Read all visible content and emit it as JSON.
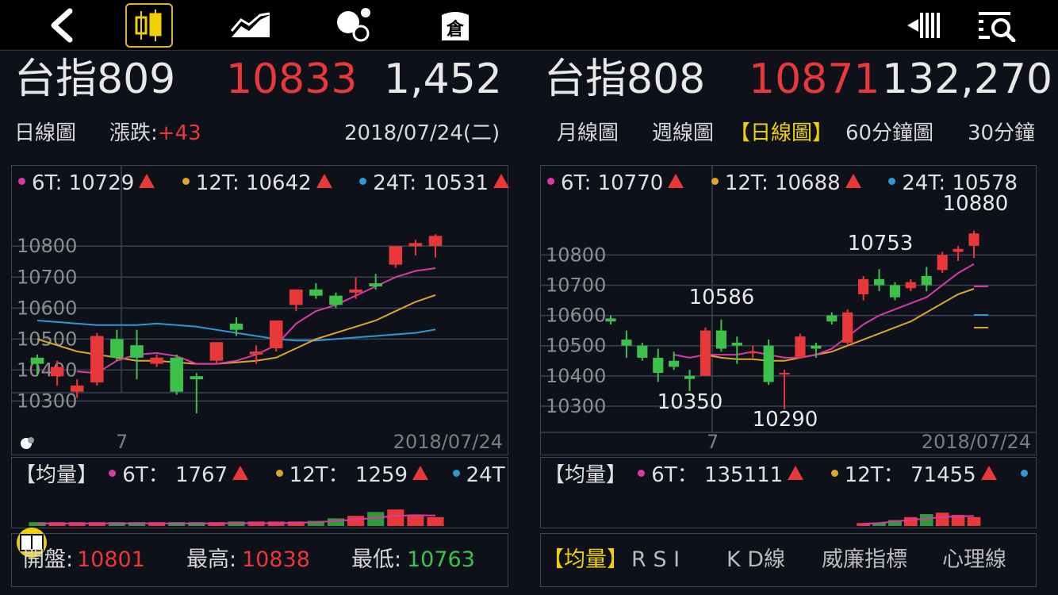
{
  "toolbar": {
    "back": "back-icon",
    "candlestick": "candlestick-icon",
    "trend": "trend-chart-icon",
    "bubbles": "bubble-icon",
    "warehouse": "warehouse-icon",
    "signal": "signal-icon",
    "search": "list-search-icon"
  },
  "left": {
    "name": "台指809",
    "price": "10833",
    "volume": "1,452",
    "period": "日線圖",
    "change_label": "漲跌:",
    "change_value": "+43",
    "date": "2018/07/24(二)",
    "ma": [
      {
        "label": "6T: 10729",
        "color": "#d63aa8"
      },
      {
        "label": "12T: 10642",
        "color": "#e0a428"
      },
      {
        "label": "24T: 10531",
        "color": "#2c98d8"
      }
    ],
    "x_tick": "7",
    "end_date": "2018/07/24",
    "vol_title": "【均量】",
    "vol_ma": [
      {
        "label": "6T： 1767",
        "color": "#d63aa8"
      },
      {
        "label": "12T： 1259",
        "color": "#e0a428"
      },
      {
        "label": "24T",
        "color": "#2c98d8"
      }
    ],
    "open_label": "開盤:",
    "open_value": "10801",
    "high_label": "最高:",
    "high_value": "10838",
    "low_label": "最低:",
    "low_value": "10763"
  },
  "right": {
    "name": "台指808",
    "price": "10871",
    "volume": "132,270",
    "tabs": [
      "月線圖",
      "週線圖",
      "【日線圖】",
      "60分鐘圖",
      "30分鐘"
    ],
    "active_tab": 2,
    "ma": [
      {
        "label": "6T: 10770",
        "color": "#d63aa8"
      },
      {
        "label": "12T: 10688",
        "color": "#e0a428"
      },
      {
        "label": "24T: 10578",
        "color": "#2c98d8"
      }
    ],
    "x_tick": "7",
    "end_date": "2018/07/24",
    "annotations": [
      "10880",
      "10753",
      "10586",
      "10350",
      "10290"
    ],
    "vol_title": "【均量】",
    "vol_ma": [
      {
        "label": "6T： 135111",
        "color": "#d63aa8"
      },
      {
        "label": "12T： 71455",
        "color": "#e0a428"
      },
      {
        "label": "",
        "color": "#2c98d8"
      }
    ],
    "indicator_tabs": [
      "【均量】",
      "R S I",
      "K D線",
      "威廉指標",
      "心理線"
    ]
  },
  "colors": {
    "up": "#e8383a",
    "down": "#3cc24a",
    "accent": "#d9b230"
  },
  "chart_data": [
    {
      "type": "bar",
      "subtype": "candlestick",
      "yticks": [
        10300,
        10400,
        10500,
        10600,
        10700,
        10800
      ],
      "ylim": [
        10250,
        10880
      ],
      "candles": [
        {
          "o": 10440,
          "h": 10450,
          "l": 10380,
          "c": 10420
        },
        {
          "o": 10380,
          "h": 10430,
          "l": 10350,
          "c": 10410
        },
        {
          "o": 10330,
          "h": 10370,
          "l": 10310,
          "c": 10350
        },
        {
          "o": 10360,
          "h": 10520,
          "l": 10350,
          "c": 10510
        },
        {
          "o": 10500,
          "h": 10530,
          "l": 10430,
          "c": 10440
        },
        {
          "o": 10480,
          "h": 10530,
          "l": 10370,
          "c": 10440
        },
        {
          "o": 10420,
          "h": 10450,
          "l": 10410,
          "c": 10440
        },
        {
          "o": 10440,
          "h": 10450,
          "l": 10320,
          "c": 10330
        },
        {
          "o": 10380,
          "h": 10390,
          "l": 10260,
          "c": 10370
        },
        {
          "o": 10430,
          "h": 10490,
          "l": 10420,
          "c": 10490
        },
        {
          "o": 10550,
          "h": 10570,
          "l": 10510,
          "c": 10530
        },
        {
          "o": 10450,
          "h": 10480,
          "l": 10420,
          "c": 10460
        },
        {
          "o": 10470,
          "h": 10560,
          "l": 10460,
          "c": 10560
        },
        {
          "o": 10610,
          "h": 10660,
          "l": 10590,
          "c": 10660
        },
        {
          "o": 10660,
          "h": 10680,
          "l": 10630,
          "c": 10640
        },
        {
          "o": 10640,
          "h": 10650,
          "l": 10600,
          "c": 10610
        },
        {
          "o": 10650,
          "h": 10700,
          "l": 10630,
          "c": 10660
        },
        {
          "o": 10680,
          "h": 10710,
          "l": 10660,
          "c": 10670
        },
        {
          "o": 10740,
          "h": 10800,
          "l": 10730,
          "c": 10800
        },
        {
          "o": 10800,
          "h": 10820,
          "l": 10770,
          "c": 10810
        },
        {
          "o": 10801,
          "h": 10838,
          "l": 10763,
          "c": 10833
        }
      ],
      "ma6": [
        10430,
        10400,
        10395,
        10390,
        10430,
        10450,
        10455,
        10445,
        10420,
        10420,
        10430,
        10450,
        10480,
        10550,
        10590,
        10610,
        10640,
        10670,
        10700,
        10720,
        10729
      ],
      "ma12": [
        10500,
        10480,
        10460,
        10450,
        10440,
        10430,
        10430,
        10425,
        10420,
        10420,
        10425,
        10430,
        10440,
        10470,
        10500,
        10520,
        10540,
        10560,
        10590,
        10620,
        10642
      ],
      "ma24": [
        10560,
        10555,
        10550,
        10545,
        10545,
        10545,
        10550,
        10545,
        10540,
        10530,
        10520,
        10510,
        10500,
        10495,
        10495,
        10500,
        10505,
        10510,
        10515,
        10520,
        10531
      ],
      "volume": [
        60,
        60,
        60,
        60,
        60,
        60,
        60,
        60,
        60,
        60,
        70,
        70,
        70,
        70,
        80,
        120,
        160,
        220,
        260,
        180,
        140
      ],
      "vol_ma": [
        40,
        40,
        40,
        40,
        40,
        40,
        40,
        40,
        40,
        40,
        45,
        45,
        45,
        50,
        60,
        80,
        100,
        130,
        160,
        170,
        165
      ]
    },
    {
      "type": "bar",
      "subtype": "candlestick",
      "yticks": [
        10300,
        10400,
        10500,
        10600,
        10700,
        10800
      ],
      "ylim": [
        10250,
        10890
      ],
      "candles": [
        {
          "o": 10590,
          "h": 10600,
          "l": 10570,
          "c": 10580
        },
        {
          "o": 10520,
          "h": 10550,
          "l": 10460,
          "c": 10500
        },
        {
          "o": 10500,
          "h": 10510,
          "l": 10450,
          "c": 10460
        },
        {
          "o": 10460,
          "h": 10490,
          "l": 10380,
          "c": 10410
        },
        {
          "o": 10450,
          "h": 10480,
          "l": 10420,
          "c": 10430
        },
        {
          "o": 10400,
          "h": 10420,
          "l": 10350,
          "c": 10390
        },
        {
          "o": 10400,
          "h": 10560,
          "l": 10400,
          "c": 10550
        },
        {
          "o": 10550,
          "h": 10586,
          "l": 10480,
          "c": 10490
        },
        {
          "o": 10510,
          "h": 10530,
          "l": 10440,
          "c": 10500
        },
        {
          "o": 10480,
          "h": 10500,
          "l": 10460,
          "c": 10480
        },
        {
          "o": 10500,
          "h": 10520,
          "l": 10370,
          "c": 10380
        },
        {
          "o": 10410,
          "h": 10420,
          "l": 10290,
          "c": 10410
        },
        {
          "o": 10460,
          "h": 10540,
          "l": 10460,
          "c": 10530
        },
        {
          "o": 10500,
          "h": 10510,
          "l": 10460,
          "c": 10490
        },
        {
          "o": 10600,
          "h": 10610,
          "l": 10570,
          "c": 10580
        },
        {
          "o": 10510,
          "h": 10620,
          "l": 10500,
          "c": 10610
        },
        {
          "o": 10670,
          "h": 10730,
          "l": 10650,
          "c": 10720
        },
        {
          "o": 10720,
          "h": 10753,
          "l": 10680,
          "c": 10700
        },
        {
          "o": 10700,
          "h": 10710,
          "l": 10650,
          "c": 10660
        },
        {
          "o": 10690,
          "h": 10720,
          "l": 10680,
          "c": 10710
        },
        {
          "o": 10730,
          "h": 10760,
          "l": 10680,
          "c": 10700
        },
        {
          "o": 10750,
          "h": 10810,
          "l": 10740,
          "c": 10800
        },
        {
          "o": 10810,
          "h": 10830,
          "l": 10780,
          "c": 10820
        },
        {
          "o": 10830,
          "h": 10880,
          "l": 10790,
          "c": 10871
        }
      ],
      "ma6": [
        10540,
        10520,
        10500,
        10480,
        10470,
        10460,
        10470,
        10470,
        10470,
        10480,
        10470,
        10460,
        10460,
        10470,
        10490,
        10530,
        10570,
        10600,
        10620,
        10640,
        10660,
        10700,
        10740,
        10770
      ],
      "ma12": [
        10560,
        10540,
        10520,
        10500,
        10490,
        10480,
        10470,
        10460,
        10455,
        10455,
        10450,
        10450,
        10460,
        10470,
        10480,
        10500,
        10520,
        10540,
        10560,
        10580,
        10610,
        10640,
        10670,
        10688
      ],
      "ma24": [
        10580,
        10570,
        10560,
        10550,
        10545,
        10540,
        10540,
        10540,
        10540,
        10545,
        10550,
        10550,
        10550,
        10550,
        10555,
        10560,
        10560,
        10565,
        10565,
        10570,
        10570,
        10575,
        10577,
        10578
      ],
      "volume": [
        40,
        40,
        40,
        40,
        40,
        40,
        40,
        40,
        40,
        40,
        40,
        40,
        40,
        40,
        40,
        40,
        40,
        40,
        80,
        120,
        160,
        180,
        150,
        120
      ],
      "vol_ma": [
        30,
        30,
        30,
        30,
        30,
        30,
        30,
        30,
        30,
        30,
        30,
        30,
        30,
        30,
        30,
        30,
        30,
        40,
        60,
        80,
        100,
        120,
        130,
        135
      ]
    }
  ]
}
